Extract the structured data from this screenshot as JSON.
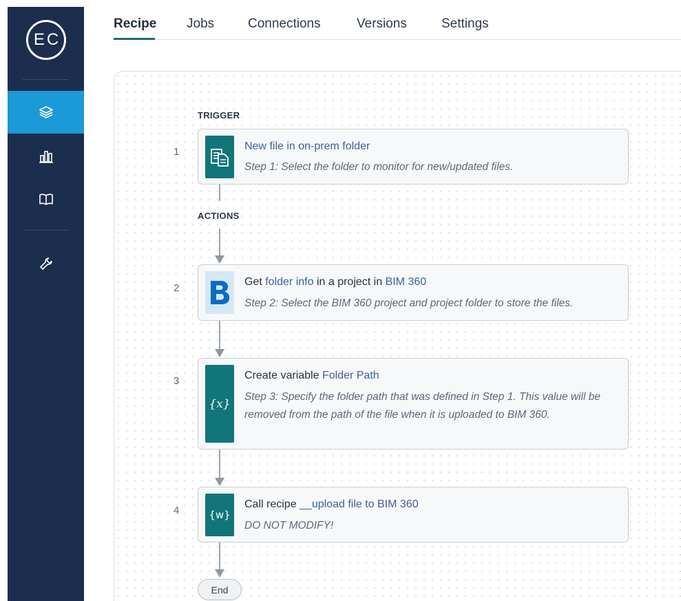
{
  "sidebar": {
    "logo_text": "EC",
    "items": [
      {
        "name": "recipes",
        "icon": "layers-icon",
        "active": true
      },
      {
        "name": "dashboard",
        "icon": "bar-chart-icon",
        "active": false
      },
      {
        "name": "docs",
        "icon": "book-icon",
        "active": false
      },
      {
        "name": "tools",
        "icon": "wrench-icon",
        "active": false
      }
    ]
  },
  "tabs": [
    {
      "label": "Recipe",
      "active": true
    },
    {
      "label": "Jobs",
      "active": false
    },
    {
      "label": "Connections",
      "active": false
    },
    {
      "label": "Versions",
      "active": false
    },
    {
      "label": "Settings",
      "active": false
    }
  ],
  "recipe": {
    "trigger_label": "TRIGGER",
    "actions_label": "ACTIONS",
    "steps": [
      {
        "number": "1",
        "icon": "file-folder-icon",
        "title_prefix": "",
        "title_link1": "New file in on-prem folder",
        "title_mid": "",
        "title_link2": "",
        "description": "Step 1: Select the folder to monitor for new/updated files."
      },
      {
        "number": "2",
        "icon": "bim360-logo-icon",
        "title_prefix": "Get ",
        "title_link1": "folder info",
        "title_mid": " in a project in ",
        "title_link2": "BIM 360",
        "description": "Step 2: Select the BIM 360 project and project folder to store the files."
      },
      {
        "number": "3",
        "icon": "variable-icon",
        "icon_text": "{x}",
        "title_prefix": "Create variable ",
        "title_link1": "Folder Path",
        "title_mid": "",
        "title_link2": "",
        "description": "Step 3: Specify the folder path that was defined in Step 1. This value will be removed from the path of the file when it is uploaded to BIM 360."
      },
      {
        "number": "4",
        "icon": "workflow-icon",
        "icon_text": "{w}",
        "title_prefix": "Call recipe ",
        "title_link1": "__upload file to BIM 360",
        "title_mid": "",
        "title_link2": "",
        "description": "DO NOT MODIFY!"
      }
    ],
    "end_label": "End"
  },
  "colors": {
    "sidebar_bg": "#1c2e4e",
    "active_nav": "#1a9ad6",
    "step_icon_teal": "#117579",
    "link": "#3b5fa0",
    "tab_underline": "#1e6a71"
  }
}
